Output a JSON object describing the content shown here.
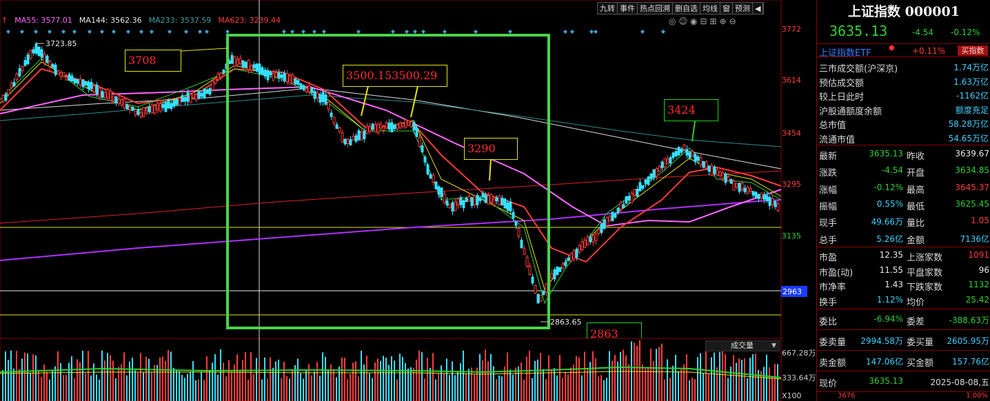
{
  "moving_averages": [
    {
      "label": "MA55: 3577.01",
      "color": "#ff66ff"
    },
    {
      "label": "MA144: 3562.36",
      "color": "#e8e8e8"
    },
    {
      "label": "MA233: 3537.59",
      "color": "#3fa0a0"
    },
    {
      "label": "MA623: 3239.44",
      "color": "#ff3b3b"
    }
  ],
  "toolbar": {
    "items": [
      "九转",
      "事件",
      "热点回溯",
      "删自选",
      "均线",
      "窗",
      "预测"
    ],
    "expand_icon": "◀"
  },
  "chart_icons": [
    "◎",
    "☺",
    "◉",
    "⊟",
    "⊞",
    "⊕",
    "⊖"
  ],
  "y_axis": {
    "labels": [
      "3772",
      "3614",
      "3454",
      "3295",
      "3135",
      "2963"
    ],
    "current_marker": "2963"
  },
  "annotations": {
    "high_label": "3723.85",
    "low_label": "2863.65",
    "box_3708": "3708",
    "box_3500": "3500.153500.29",
    "box_3290": "3290",
    "box_3424": "3424",
    "box_2863": "2863"
  },
  "volume": {
    "selector": "成交量",
    "labels": [
      "667.28万",
      "333.64万",
      "X100"
    ]
  },
  "side": {
    "title": "上证指数 000001",
    "last": "3635.13",
    "change": "-4.54",
    "change_pct": "-0.12%",
    "etf_name": "上证指数ETF",
    "etf_pct": "+0.11%",
    "etf_button": "买指数",
    "info": [
      {
        "k": "三市成交额(沪深京)",
        "v": "1.74万亿",
        "c": "cyan"
      },
      {
        "k": "预估成交额",
        "v": "1.63万亿",
        "c": "cyan"
      },
      {
        "k": "较上日此时",
        "v": "-1162亿",
        "c": "cyan"
      },
      {
        "k": "沪股通额度余额",
        "v": "额度充足",
        "c": "cyan"
      },
      {
        "k": "总市值",
        "v": "58.28万亿",
        "c": "cyan"
      },
      {
        "k": "流通市值",
        "v": "54.65万亿",
        "c": "cyan"
      }
    ],
    "quotes": [
      {
        "k1": "最新",
        "v1": "3635.13",
        "c1": "green",
        "k2": "昨收",
        "v2": "3639.67",
        "c2": "white"
      },
      {
        "k1": "涨跌",
        "v1": "-4.54",
        "c1": "green",
        "k2": "开盘",
        "v2": "3634.85",
        "c2": "green"
      },
      {
        "k1": "涨幅",
        "v1": "-0.12%",
        "c1": "green",
        "k2": "最高",
        "v2": "3645.37",
        "c2": "red"
      },
      {
        "k1": "振幅",
        "v1": "0.55%",
        "c1": "cyan",
        "k2": "最低",
        "v2": "3625.45",
        "c2": "green"
      },
      {
        "k1": "现手",
        "v1": "49.66万",
        "c1": "cyan",
        "k2": "量比",
        "v2": "1.05",
        "c2": "red"
      },
      {
        "k1": "总手",
        "v1": "5.26亿",
        "c1": "cyan",
        "k2": "金额",
        "v2": "7136亿",
        "c2": "cyan"
      }
    ],
    "valuation": [
      {
        "k1": "市盈",
        "v1": "12.35",
        "c1": "white",
        "k2": "上涨家数",
        "v2": "1091",
        "c2": "red"
      },
      {
        "k1": "市盈(动)",
        "v1": "11.55",
        "c1": "white",
        "k2": "平盘家数",
        "v2": "96",
        "c2": "white"
      },
      {
        "k1": "市净率",
        "v1": "1.43",
        "c1": "white",
        "k2": "下跌家数",
        "v2": "1132",
        "c2": "green"
      },
      {
        "k1": "换手",
        "v1": "1.12%",
        "c1": "cyan",
        "k2": "均价",
        "v2": "25.42",
        "c2": "green"
      }
    ],
    "order_ratio": {
      "k1": "委比",
      "v1": "-6.94%",
      "c1": "green",
      "k2": "委差",
      "v2": "-388.63万",
      "c2": "green"
    },
    "order_vol": {
      "k1": "委卖量",
      "v1": "2994.58万",
      "c1": "cyan",
      "k2": "委买量",
      "v2": "2605.95万",
      "c2": "cyan"
    },
    "order_amt": {
      "k1": "卖金额",
      "v1": "147.06亿",
      "c1": "cyan",
      "k2": "买金额",
      "v2": "157.76亿",
      "c2": "cyan"
    },
    "footer": {
      "k": "现价",
      "v": "3635.13",
      "date": "2025-08-08,五",
      "left_val": "3676",
      "right_val": "1.00%"
    }
  }
}
